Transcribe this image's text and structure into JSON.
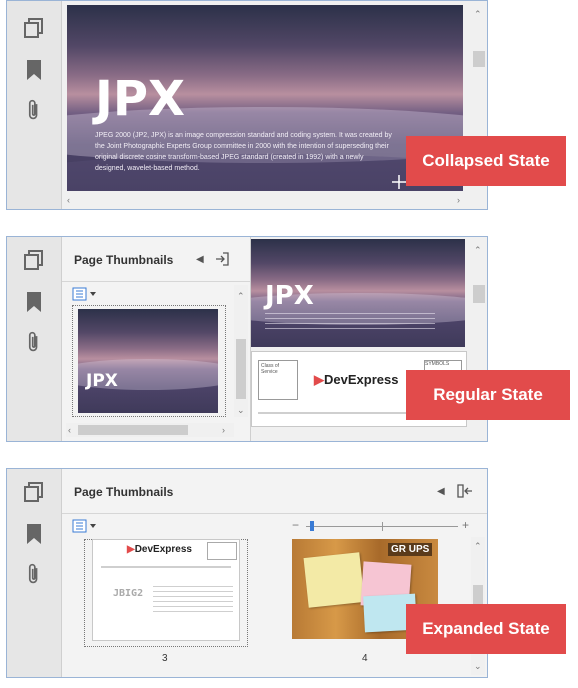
{
  "badges": {
    "collapsed": "Collapsed State",
    "regular": "Regular State",
    "expanded": "Expanded State"
  },
  "panel": {
    "title": "Page Thumbnails"
  },
  "document": {
    "heading": "JPX",
    "paragraph": "JPEG 2000 (JP2, JPX) is an image compression standard and coding system. It was created by the Joint Photographic Experts Group committee in 2000 with the intention of superseding their original discrete cosine transform-based JPEG standard (created in 1992) with a newly designed, wavelet-based method.",
    "logo": "DevExpress",
    "stamp_label": "Class of Service",
    "symbols_label": "SYMBOLS",
    "jbig_label": "JBIG2",
    "groups_text": "GR UPS"
  },
  "thumbnails": {
    "labels": [
      "3",
      "4"
    ]
  },
  "colors": {
    "badge": "#e24b4b",
    "frame": "#9ab4d6",
    "sidebar": "#e6e6e6"
  },
  "icons": [
    "pages-icon",
    "bookmark-icon",
    "paperclip-icon",
    "menu-icon",
    "collapse-panel-icon",
    "close-panel-icon"
  ]
}
